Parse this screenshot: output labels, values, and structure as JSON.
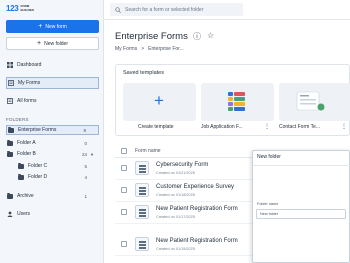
{
  "sidebar": {
    "logo_mark": "123",
    "logo_text_line1": "FORM",
    "logo_text_line2": "BUILDER",
    "new_form_label": "New form",
    "new_folder_label": "New folder",
    "nav": [
      {
        "label": "Dashboard",
        "icon": "dashboard-icon"
      },
      {
        "label": "My Forms",
        "icon": "my-forms-icon"
      },
      {
        "label": "All forms",
        "icon": "all-forms-icon"
      }
    ],
    "folders_heading": "FOLDERS",
    "folders": [
      {
        "label": "Enterprise Forms",
        "count": "8"
      },
      {
        "label": "Folder A",
        "count": "0"
      },
      {
        "label": "Folder B",
        "count": "24"
      },
      {
        "label": "Folder C",
        "count": "5"
      },
      {
        "label": "Folder D",
        "count": "4"
      }
    ],
    "archive_label": "Archive",
    "archive_count": "1",
    "users_label": "Users"
  },
  "topbar": {
    "search_placeholder": "Search for a form or selected folder"
  },
  "main": {
    "title": "Enterprise Forms",
    "breadcrumb": [
      "My Forms",
      ">",
      "Enterprise For..."
    ],
    "saved_templates_title": "Saved templates",
    "templates": [
      {
        "label": "Create template"
      },
      {
        "label": "Job Application F..."
      },
      {
        "label": "Contact Form Te..."
      }
    ],
    "table_header": "Form name",
    "rows": [
      {
        "title": "Cybersecurity Form",
        "date": "Created on 01/21/2025"
      },
      {
        "title": "Customer Experience Survey",
        "date": "Created on 01/18/2025"
      },
      {
        "title": "New Patient Registration Form",
        "date": "Created on 01/17/2025"
      },
      {
        "title": "New Patient Registration Form",
        "date": "Created on 01/15/2025"
      }
    ]
  },
  "panel": {
    "title": "New folder",
    "name_label": "Folder name",
    "name_value": "New folder",
    "location_label": "Location",
    "location_value": "My Forms",
    "tab_color": "Folder color",
    "tab_icon": "Folder icon",
    "preview_label": "Folder preview",
    "swatches": [
      "#6b7684",
      "#7d8a99",
      "#e0555b",
      "#49a36b",
      "#2aa3a6",
      "#d9568a",
      "#2f6fd6"
    ]
  },
  "colors": {
    "accent": "#1a73e8"
  }
}
